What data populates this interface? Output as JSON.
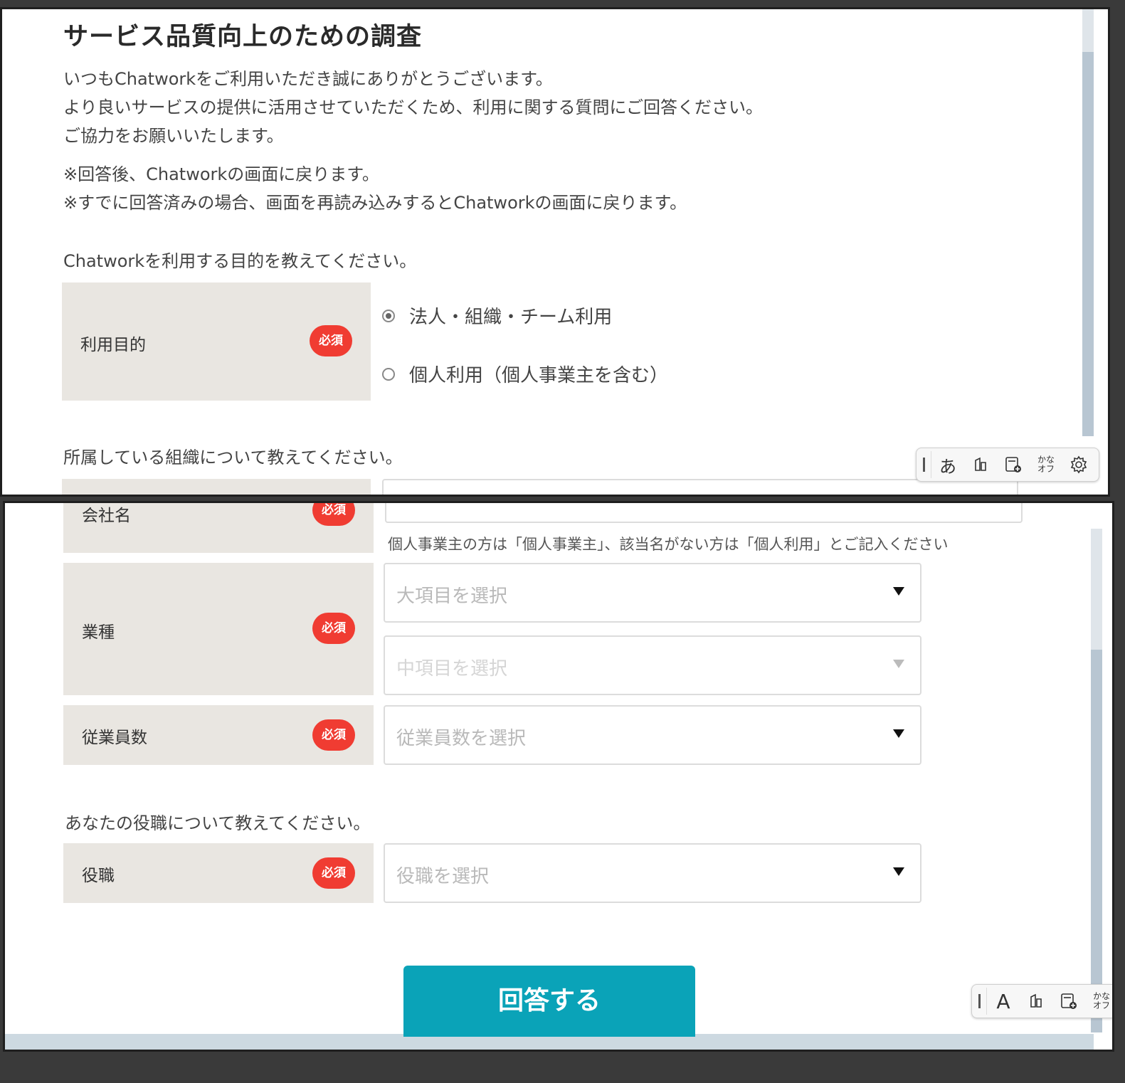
{
  "survey": {
    "title": "サービス品質向上のための調査",
    "intro": [
      "いつもChatworkをご利用いただき誠にありがとうございます。",
      "より良いサービスの提供に活用させていただくため、利用に関する質問にご回答ください。",
      "ご協力をお願いいたします。"
    ],
    "notes": [
      "※回答後、Chatworkの画面に戻ります。",
      "※すでに回答済みの場合、画面を再読み込みするとChatworkの画面に戻ります。"
    ],
    "required_badge": "必須"
  },
  "q_purpose": {
    "title": "Chatworkを利用する目的を教えてください。",
    "label": "利用目的",
    "options": [
      {
        "label": "法人・組織・チーム利用",
        "selected": true
      },
      {
        "label": "個人利用（個人事業主を含む）",
        "selected": false
      }
    ]
  },
  "q_org": {
    "title": "所属している組織について教えてください。",
    "company": {
      "label": "会社名",
      "hint": "個人事業主の方は「個人事業主」、該当名がない方は「個人利用」とご記入ください"
    },
    "industry": {
      "label": "業種",
      "major_placeholder": "大項目を選択",
      "minor_placeholder": "中項目を選択"
    },
    "employees": {
      "label": "従業員数",
      "placeholder": "従業員数を選択"
    }
  },
  "q_role": {
    "title": "あなたの役職について教えてください。",
    "label": "役職",
    "placeholder": "役職を選択"
  },
  "submit_label": "回答する",
  "ime_toolbar_top": {
    "mode": "あ",
    "kana_off": [
      "かな",
      "オフ"
    ],
    "icons": [
      "ime-grip-icon",
      "ime-pad-icon",
      "dictionary-add-icon",
      "settings-gear-icon"
    ]
  },
  "ime_toolbar_bottom": {
    "mode": "A",
    "kana_off": [
      "かな",
      "オフ"
    ]
  },
  "colors": {
    "required_badge": "#f03c32",
    "label_cell_bg": "#e9e6e1",
    "submit_button": "#0aa3b8"
  }
}
